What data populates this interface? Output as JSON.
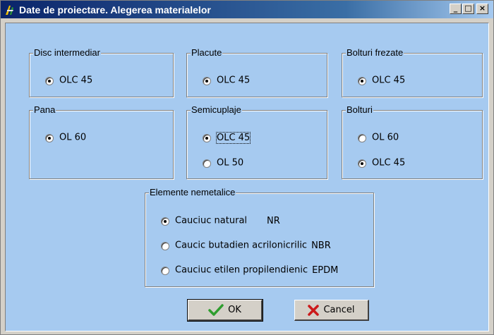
{
  "window": {
    "title": "Date de proiectare. Alegerea materialelor",
    "buttons": {
      "minimize": "_",
      "maximize": "□",
      "close": "×"
    }
  },
  "groups": {
    "disc": {
      "label": "Disc intermediar",
      "options": [
        {
          "label": "OLC 45",
          "checked": true
        }
      ]
    },
    "placute": {
      "label": "Placute",
      "options": [
        {
          "label": "OLC 45",
          "checked": true
        }
      ]
    },
    "bolturi_frezate": {
      "label": "Bolturi frezate",
      "options": [
        {
          "label": "OLC 45",
          "checked": true
        }
      ]
    },
    "pana": {
      "label": "Pana",
      "options": [
        {
          "label": "OL 60",
          "checked": true
        }
      ]
    },
    "semicuplaje": {
      "label": "Semicuplaje",
      "options": [
        {
          "label": "OLC 45",
          "checked": true
        },
        {
          "label": "OL 50",
          "checked": false
        }
      ]
    },
    "bolturi": {
      "label": "Bolturi",
      "options": [
        {
          "label": "OL 60",
          "checked": false
        },
        {
          "label": "OLC 45",
          "checked": true
        }
      ]
    },
    "elemente": {
      "label": "Elemente nemetalice",
      "options": [
        {
          "label": "Cauciuc natural",
          "code": "NR",
          "checked": true
        },
        {
          "label": "Caucic butadien acrilonicrilic",
          "code": "NBR",
          "checked": false
        },
        {
          "label": "Cauciuc etilen propilendienic",
          "code": "EPDM",
          "checked": false
        }
      ]
    }
  },
  "actions": {
    "ok": "OK",
    "cancel": "Cancel"
  },
  "icons": {
    "ok": "checkmark-icon",
    "cancel": "x-icon",
    "app": "app-icon"
  },
  "colors": {
    "client_bg": "#a6caf0",
    "ok_check": "#2e9e2e",
    "cancel_x": "#cc1a1a"
  }
}
